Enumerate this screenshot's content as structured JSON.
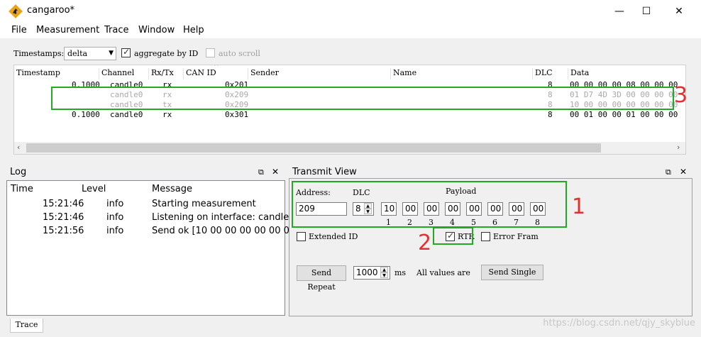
{
  "window": {
    "title": "cangaroo*"
  },
  "menu": [
    "File",
    "Measurement",
    "Trace",
    "Window",
    "Help"
  ],
  "toolbar": {
    "timestamps_label": "Timestamps:",
    "timestamps_value": "delta",
    "aggregate_label": "aggregate by ID",
    "aggregate_checked": true,
    "autoscroll_label": "auto scroll",
    "autoscroll_checked": false
  },
  "trace": {
    "columns": [
      "Timestamp",
      "Channel",
      "Rx/Tx",
      "CAN ID",
      "Sender",
      "Name",
      "DLC",
      "Data"
    ],
    "rows": [
      {
        "timestamp": "0.1000",
        "channel": "candle0",
        "rxtx": "rx",
        "id": "0x201",
        "sender": "",
        "name": "",
        "dlc": "8",
        "data": "00 00 00 00 08 00 00 00",
        "dimmed": false
      },
      {
        "timestamp": "",
        "channel": "candle0",
        "rxtx": "rx",
        "id": "0x209",
        "sender": "",
        "name": "",
        "dlc": "8",
        "data": "01 D7 4D 3D 00 00 00 00",
        "dimmed": true
      },
      {
        "timestamp": "",
        "channel": "candle0",
        "rxtx": "tx",
        "id": "0x209",
        "sender": "",
        "name": "",
        "dlc": "8",
        "data": "10 00 00 00 00 00 00 00",
        "dimmed": true
      },
      {
        "timestamp": "0.1000",
        "channel": "candle0",
        "rxtx": "rx",
        "id": "0x301",
        "sender": "",
        "name": "",
        "dlc": "8",
        "data": "00 01 00 00 01 00 00 00",
        "dimmed": false
      }
    ]
  },
  "log": {
    "title": "Log",
    "columns": [
      "Time",
      "Level",
      "Message"
    ],
    "rows": [
      {
        "time": "15:21:46",
        "level": "info",
        "message": "Starting measurement"
      },
      {
        "time": "15:21:46",
        "level": "info",
        "message": "Listening on interface: candle0"
      },
      {
        "time": "15:21:56",
        "level": "info",
        "message": "Send ok [10 00 00 00 00 00 0..."
      }
    ]
  },
  "transmit": {
    "title": "Transmit View",
    "address_label": "Address:",
    "dlc_label": "DLC",
    "payload_label": "Payload",
    "address_value": "209",
    "dlc_value": "8",
    "payload": [
      "10",
      "00",
      "00",
      "00",
      "00",
      "00",
      "00",
      "00"
    ],
    "byte_numbers": [
      "1",
      "2",
      "3",
      "4",
      "5",
      "6",
      "7",
      "8"
    ],
    "extended_id_label": "Extended ID",
    "extended_id_checked": false,
    "rtr_label": "RTR",
    "rtr_checked": true,
    "error_frame_label": "Error Fram",
    "error_frame_checked": false,
    "send_repeat_label": "Send Repeat",
    "interval_value": "1000",
    "interval_unit": "ms",
    "all_values_text": "All values are",
    "send_single_label": "Send Single"
  },
  "annotations": {
    "one": "1",
    "two": "2",
    "three": "3"
  },
  "status": {
    "tab": "Trace",
    "watermark": "https://blog.csdn.net/qjy_skyblue"
  },
  "colors": {
    "annotation_green": "#22aa22",
    "annotation_red": "#e53030",
    "app_icon": "#e8a317"
  }
}
